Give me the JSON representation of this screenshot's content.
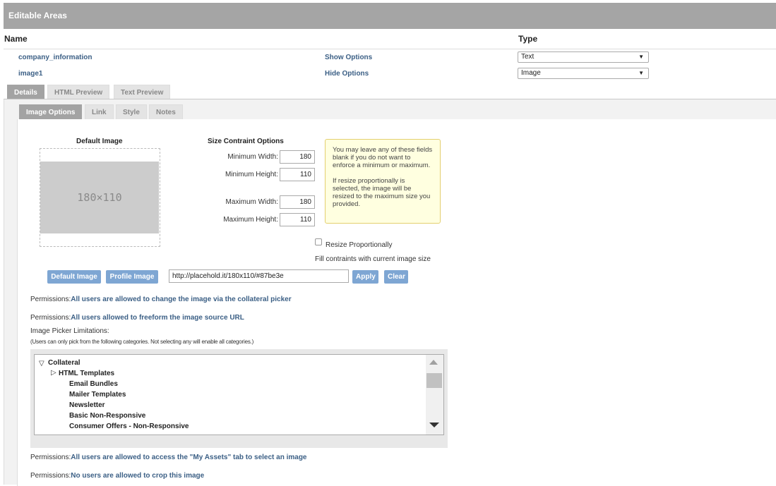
{
  "header": {
    "title": "Editable Areas"
  },
  "columns": {
    "name": "Name",
    "type": "Type"
  },
  "rows": [
    {
      "name": "company_information",
      "toggle": "Show Options",
      "type": "Text"
    },
    {
      "name": "image1",
      "toggle": "Hide Options",
      "type": "Image"
    }
  ],
  "tabs": [
    "Details",
    "HTML Preview",
    "Text Preview"
  ],
  "subtabs": [
    "Image Options",
    "Link",
    "Style",
    "Notes"
  ],
  "image_options": {
    "default_image_label": "Default Image",
    "placeholder_text": "180×110",
    "size_title": "Size Contraint Options",
    "min_width_label": "Minimum Width:",
    "min_width": "180",
    "min_height_label": "Minimum Height:",
    "min_height": "110",
    "max_width_label": "Maximum Width:",
    "max_width": "180",
    "max_height_label": "Maximum Height:",
    "max_height": "110",
    "note_p1": "You may leave any of these fields blank if you do not want to enforce a minimum or maximum.",
    "note_p2": "If resize proportionally is selected, the image will be resized to the maximum size you provided.",
    "resize_label": "Resize Proportionally",
    "fill_text": "Fill contraints with current image size",
    "btn_default_image": "Default Image",
    "btn_profile_image": "Profile Image",
    "url": "http://placehold.it/180x110/#87be3e",
    "btn_apply": "Apply",
    "btn_clear": "Clear"
  },
  "permissions": {
    "prefix": "Permissions:",
    "p1": "All users are allowed to change the image via the collateral picker",
    "p2": "All users allowed to freeform the image source URL",
    "p3": "All users are allowed to access the \"My Assets\" tab to select an image",
    "p4": "No users are allowed to crop this image"
  },
  "picker": {
    "title": "Image Picker Limitations:",
    "subtitle": "(Users can only pick from the following categories. Not selecting any will enable all categories.)",
    "root": "Collateral",
    "child": "HTML Templates",
    "items": [
      "Email Bundles",
      "Mailer Templates",
      "Newsletter",
      "Basic Non-Responsive",
      "Consumer Offers - Non-Responsive"
    ]
  },
  "colors": {
    "header_bg": "#a5a5a5",
    "link": "#3b5f85",
    "button": "#7ea6d3",
    "note_bg": "#ffffe0"
  }
}
